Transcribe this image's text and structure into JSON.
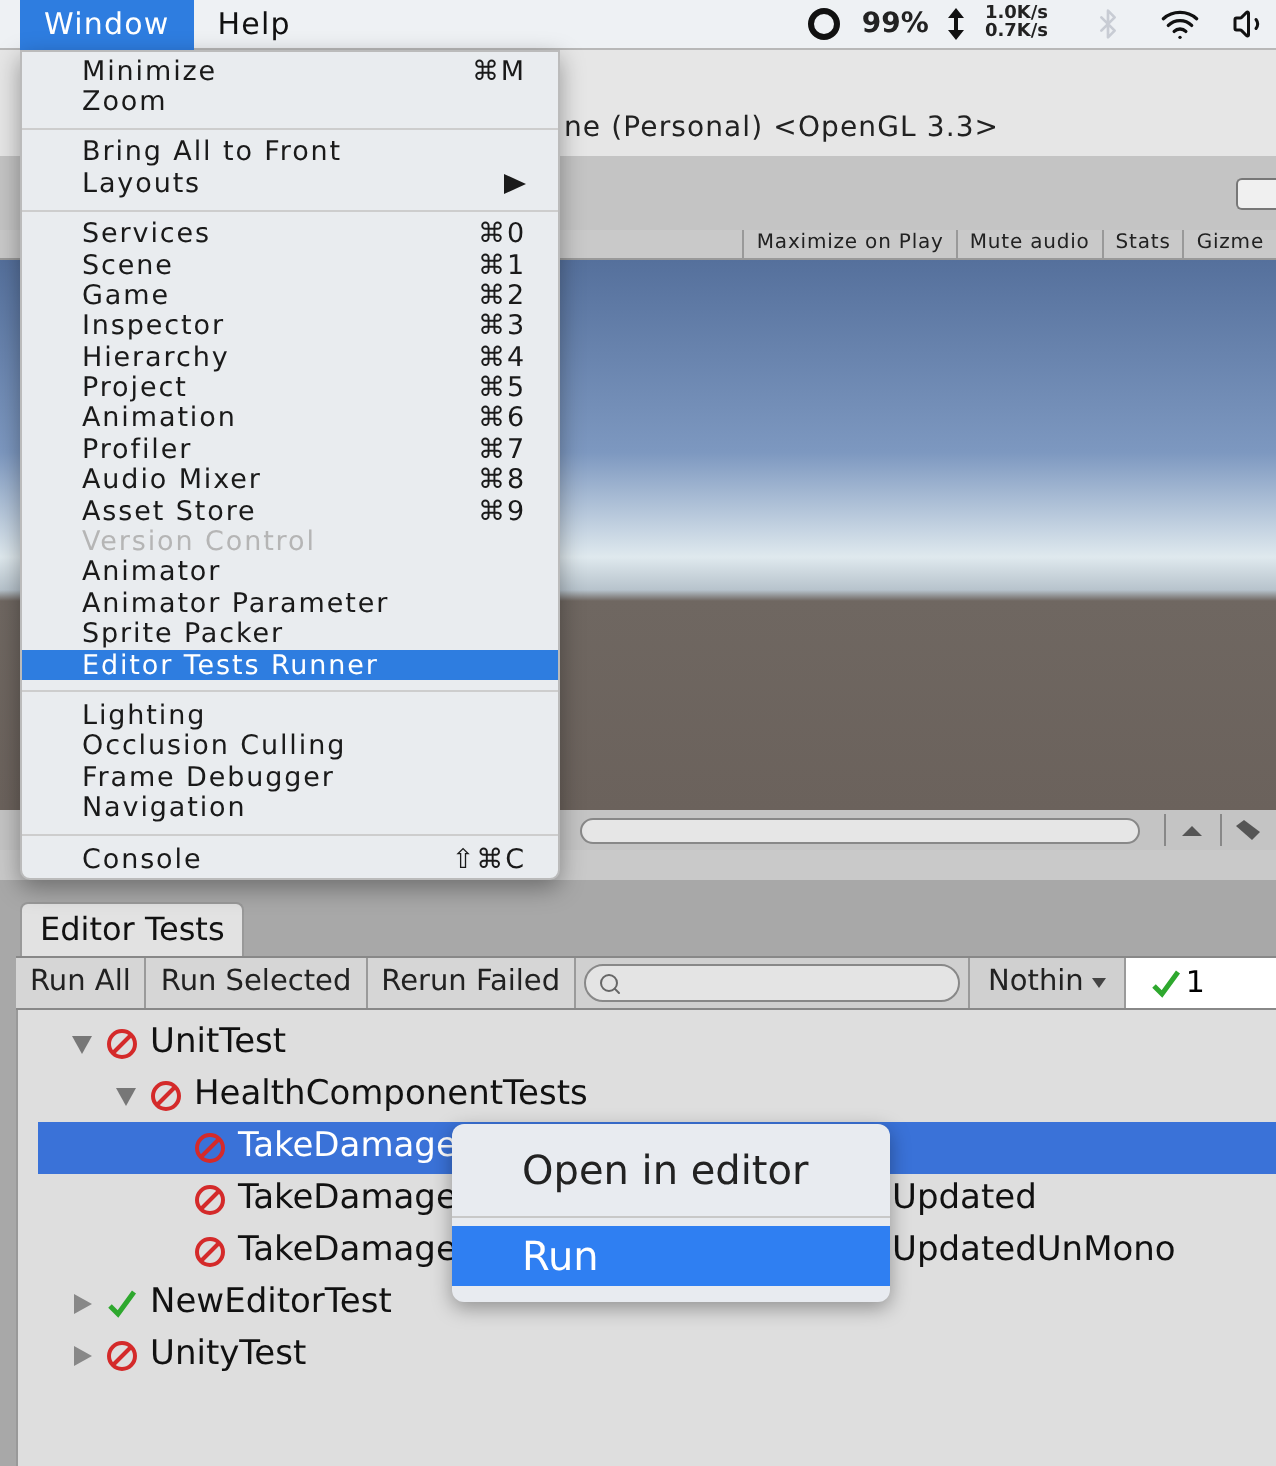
{
  "menu_bar": {
    "items": [
      {
        "label": "Window",
        "selected": true
      },
      {
        "label": "Help",
        "selected": false
      }
    ],
    "battery": "99%",
    "net_up": "1.0K/s",
    "net_down": "0.7K/s"
  },
  "window_menu": {
    "groups": [
      [
        {
          "label": "Minimize",
          "shortcut": "⌘M",
          "selected": false,
          "disabled": false
        },
        {
          "label": "Zoom",
          "selected": false,
          "disabled": false
        }
      ],
      [
        {
          "label": "Bring All to Front",
          "selected": false,
          "disabled": false
        },
        {
          "label": "Layouts",
          "submenu": true,
          "selected": false,
          "disabled": false
        }
      ],
      [
        {
          "label": "Services",
          "shortcut": "⌘0",
          "selected": false,
          "disabled": false
        },
        {
          "label": "Scene",
          "shortcut": "⌘1",
          "selected": false,
          "disabled": false
        },
        {
          "label": "Game",
          "shortcut": "⌘2",
          "selected": false,
          "disabled": false
        },
        {
          "label": "Inspector",
          "shortcut": "⌘3",
          "selected": false,
          "disabled": false
        },
        {
          "label": "Hierarchy",
          "shortcut": "⌘4",
          "selected": false,
          "disabled": false
        },
        {
          "label": "Project",
          "shortcut": "⌘5",
          "selected": false,
          "disabled": false
        },
        {
          "label": "Animation",
          "shortcut": "⌘6",
          "selected": false,
          "disabled": false
        },
        {
          "label": "Profiler",
          "shortcut": "⌘7",
          "selected": false,
          "disabled": false
        },
        {
          "label": "Audio Mixer",
          "shortcut": "⌘8",
          "selected": false,
          "disabled": false
        },
        {
          "label": "Asset Store",
          "shortcut": "⌘9",
          "selected": false,
          "disabled": false
        },
        {
          "label": "Version Control",
          "selected": false,
          "disabled": true
        },
        {
          "label": "Animator",
          "selected": false,
          "disabled": false
        },
        {
          "label": "Animator Parameter",
          "selected": false,
          "disabled": false
        },
        {
          "label": "Sprite Packer",
          "selected": false,
          "disabled": false
        },
        {
          "label": "Editor Tests Runner",
          "selected": true,
          "disabled": false
        }
      ],
      [
        {
          "label": "Lighting",
          "selected": false,
          "disabled": false
        },
        {
          "label": "Occlusion Culling",
          "selected": false,
          "disabled": false
        },
        {
          "label": "Frame Debugger",
          "selected": false,
          "disabled": false
        },
        {
          "label": "Navigation",
          "selected": false,
          "disabled": false
        }
      ],
      [
        {
          "label": "Console",
          "shortcut": "⇧⌘C",
          "selected": false,
          "disabled": false
        }
      ]
    ]
  },
  "unity_window": {
    "title": "ne (Personal) <OpenGL 3.3>",
    "game_toolbar": [
      "Maximize on Play",
      "Mute audio",
      "Stats",
      "Gizme"
    ]
  },
  "editor_tests": {
    "tab": "Editor Tests",
    "toolbar_buttons": [
      "Run All",
      "Run Selected",
      "Rerun Failed"
    ],
    "filter": "Nothin",
    "passed_count": "1",
    "tree": [
      {
        "label": "UnitTest",
        "passed": false,
        "expanded": true,
        "selected": false,
        "children": [
          {
            "label": "HealthComponentTests",
            "passed": false,
            "expanded": true,
            "selected": false,
            "children": [
              {
                "label": "TakeDamage",
                "passed": false,
                "selected": true
              },
              {
                "label": "TakeDamage",
                "tail": "Updated",
                "passed": false,
                "selected": false
              },
              {
                "label": "TakeDamage",
                "tail": "UpdatedUnMono",
                "passed": false,
                "selected": false
              }
            ]
          }
        ]
      },
      {
        "label": "NewEditorTest",
        "passed": true,
        "expanded": false,
        "selected": false
      },
      {
        "label": "UnityTest",
        "passed": false,
        "expanded": false,
        "selected": false
      }
    ]
  },
  "context_menu": {
    "items": [
      {
        "label": "Open in editor",
        "selected": false
      },
      {
        "label": "Run",
        "selected": true
      }
    ]
  }
}
